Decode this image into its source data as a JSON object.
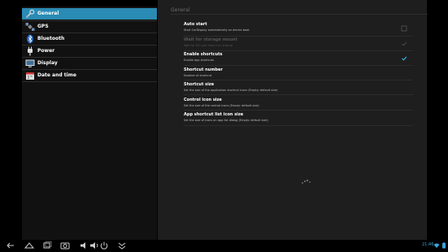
{
  "sidebar": {
    "items": [
      {
        "label": "General",
        "icon": "wrench-icon",
        "selected": true
      },
      {
        "label": "GPS",
        "icon": "satellite-icon",
        "selected": false
      },
      {
        "label": "Bluetooth",
        "icon": "bluetooth-icon",
        "selected": false
      },
      {
        "label": "Power",
        "icon": "power-plug-icon",
        "selected": false
      },
      {
        "label": "Display",
        "icon": "monitor-icon",
        "selected": false
      },
      {
        "label": "Date and time",
        "icon": "calendar-icon",
        "selected": false
      }
    ]
  },
  "main": {
    "section_title": "General",
    "prefs": [
      {
        "title": "Auto start",
        "summary": "Start CarDisplay automatically on device boot",
        "checkbox": true,
        "checked": false,
        "enabled": true
      },
      {
        "title": "Wait for storage mount",
        "summary": "Wait for SD card mount on startup",
        "checkbox": true,
        "checked": true,
        "enabled": false
      },
      {
        "title": "Enable shortcuts",
        "summary": "Enable app shortcuts",
        "checkbox": true,
        "checked": true,
        "enabled": true
      },
      {
        "title": "Shortcut number",
        "summary": "Number of shortcut",
        "checkbox": false,
        "enabled": true
      },
      {
        "title": "Shortcut size",
        "summary": "Set the size of the application shortcut icons (Empty: default size)",
        "checkbox": false,
        "enabled": true
      },
      {
        "title": "Control icon size",
        "summary": "Set the size of the control icons (Empty: default size)",
        "checkbox": false,
        "enabled": true
      },
      {
        "title": "App shortcut list icon size",
        "summary": "Set the size of icons on app list dialog (Empty: default size)",
        "checkbox": false,
        "enabled": true
      }
    ]
  },
  "navbar": {
    "clock": "21:46",
    "buttons": [
      "back-icon",
      "home-icon",
      "recent-apps-icon",
      "screenshot-icon",
      "volume-down-icon",
      "volume-up-icon",
      "power-icon",
      "collapse-icon"
    ]
  },
  "colors": {
    "accent": "#2a8bb4",
    "clock": "#3aa3d6",
    "panel_bg": "#1e1e1e",
    "sidebar_bg": "#111111"
  }
}
